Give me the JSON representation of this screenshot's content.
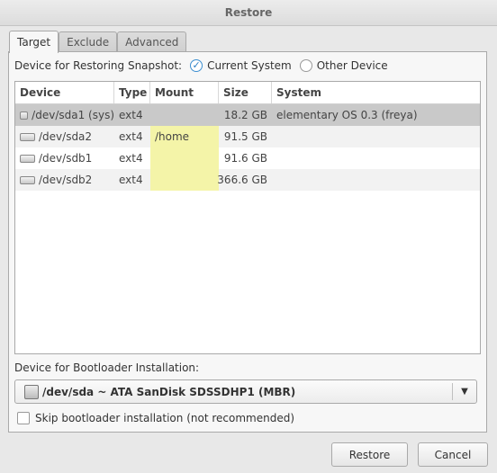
{
  "window": {
    "title": "Restore"
  },
  "tabs": [
    {
      "label": "Target",
      "active": true
    },
    {
      "label": "Exclude",
      "active": false
    },
    {
      "label": "Advanced",
      "active": false
    }
  ],
  "restore_target": {
    "label": "Device for Restoring Snapshot:",
    "options": [
      {
        "label": "Current System",
        "selected": true
      },
      {
        "label": "Other Device",
        "selected": false
      }
    ]
  },
  "table": {
    "columns": [
      "Device",
      "Type",
      "Mount",
      "Size",
      "System"
    ],
    "rows": [
      {
        "device": "/dev/sda1 (sys)",
        "type": "ext4",
        "mount": "",
        "size": "18.2 GB",
        "system": "elementary OS 0.3 (freya)",
        "selected": true
      },
      {
        "device": "/dev/sda2",
        "type": "ext4",
        "mount": "/home",
        "size": "91.5 GB",
        "system": ""
      },
      {
        "device": "/dev/sdb1",
        "type": "ext4",
        "mount": "",
        "size": "91.6 GB",
        "system": ""
      },
      {
        "device": "/dev/sdb2",
        "type": "ext4",
        "mount": "",
        "size": "366.6 GB",
        "system": ""
      }
    ]
  },
  "bootloader": {
    "label": "Device for Bootloader Installation:",
    "selected": "/dev/sda ~ ATA SanDisk SDSSDHP1 (MBR)",
    "skip_label": "Skip bootloader installation (not recommended)",
    "skip_checked": false
  },
  "buttons": {
    "restore": "Restore",
    "cancel": "Cancel"
  },
  "colors": {
    "accent": "#3d8fd0",
    "mount_highlight": "#f4f4a8",
    "selected_row": "#c9c9c9"
  }
}
